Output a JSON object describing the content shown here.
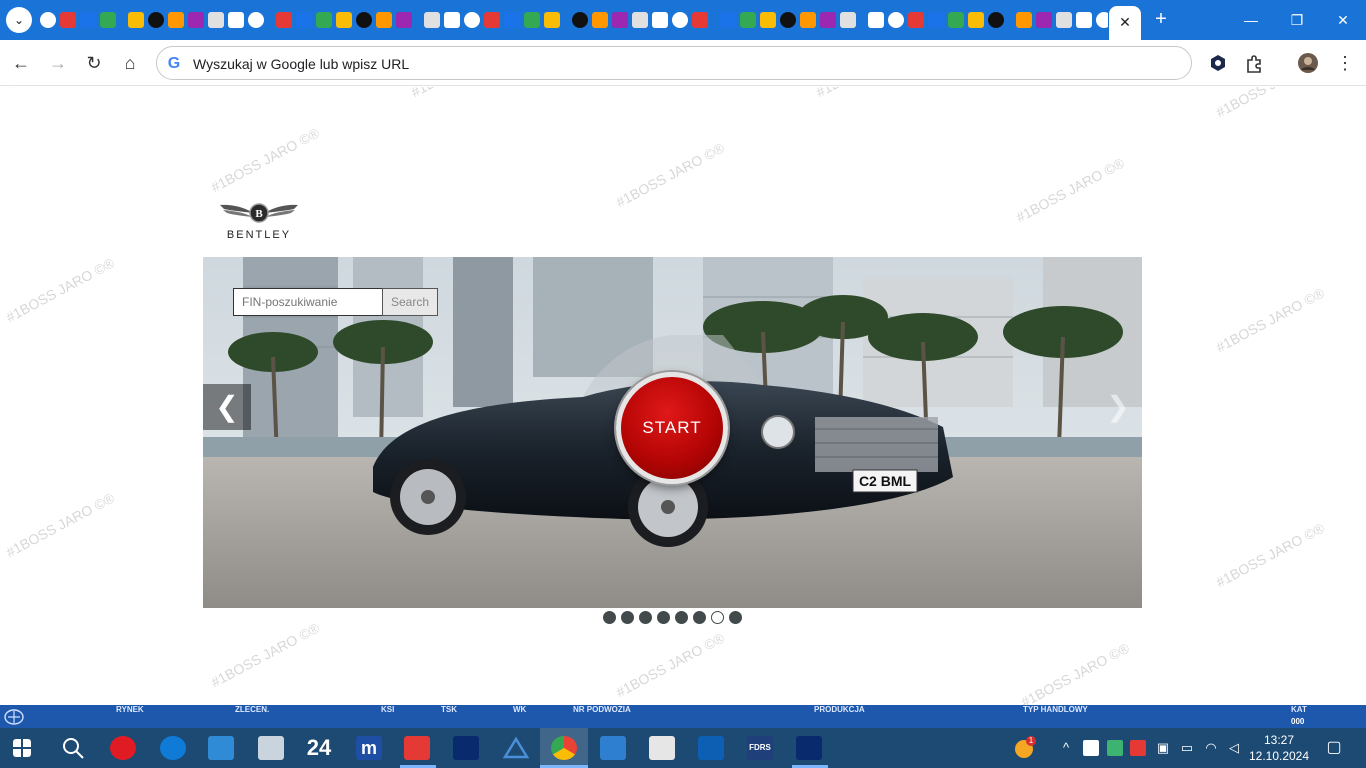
{
  "browser": {
    "address_placeholder": "Wyszukaj w Google lub wpisz URL",
    "google_glyph": "G",
    "new_tab_glyph": "+",
    "close_tab_glyph": "✕",
    "window_controls": {
      "minimize": "—",
      "maximize": "❐",
      "close": "✕"
    },
    "nav": {
      "back": "←",
      "forward": "→",
      "reload": "↻",
      "home": "⌂",
      "menu": "⋮"
    }
  },
  "page": {
    "brand": "BENTLEY",
    "search_placeholder": "FIN-poszukiwanie",
    "search_button": "Search",
    "start_button": "START",
    "prev_arrow": "❮",
    "next_arrow": "❯",
    "license_plate": "C2 BML",
    "slides_total": 8,
    "active_slide": 7,
    "watermark": "#1BOSS JARO ©®"
  },
  "appbar": {
    "labels": [
      "RYNEK",
      "ZLECEN.",
      "KSI",
      "TSK",
      "WK",
      "NR PODWOZIA",
      "PRODUKCJA",
      "TYP HANDLOWY",
      "KAT"
    ],
    "kat_value": "000"
  },
  "taskbar": {
    "time": "13:27",
    "date": "12.10.2024",
    "notification_count": "1",
    "app_24_label": "24"
  },
  "colors": {
    "tabstrip": "#1a73d6",
    "appbar": "#1e58ad",
    "taskbar": "#1c4a73",
    "start_red": "#b50505"
  }
}
